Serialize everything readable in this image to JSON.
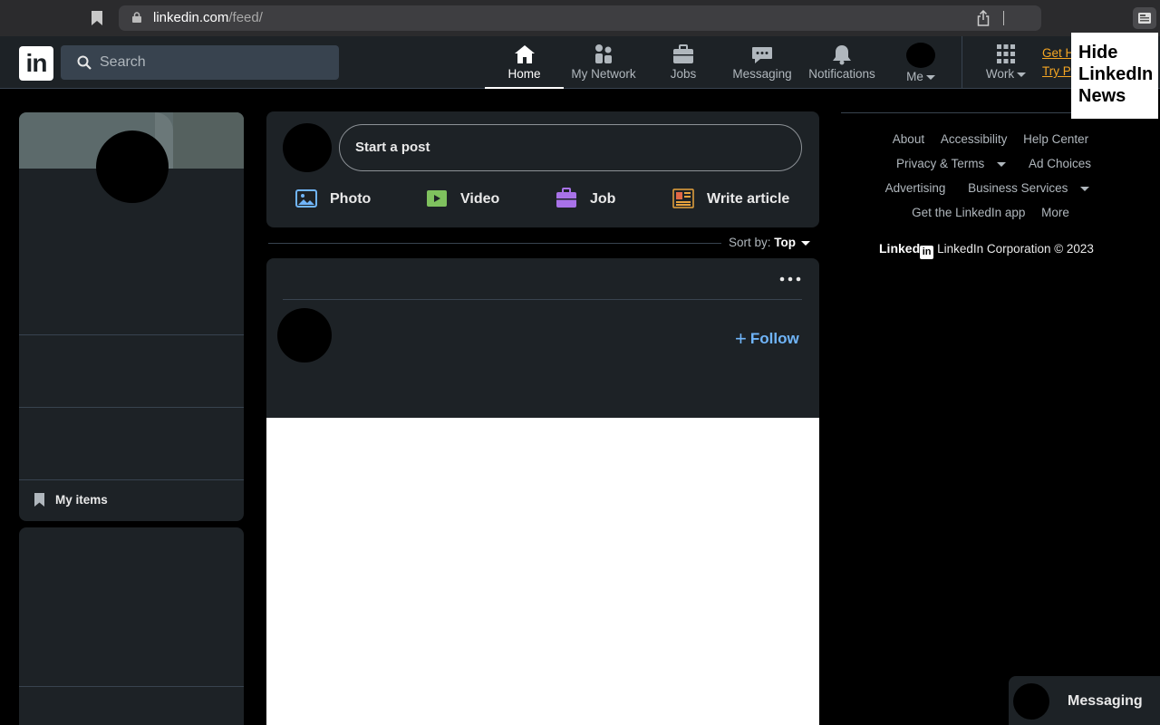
{
  "browser": {
    "url_host": "linkedin.com",
    "url_path": "/feed/"
  },
  "nav": {
    "logo": "in",
    "search_placeholder": "Search",
    "items": [
      {
        "label": "Home",
        "icon": "home-icon",
        "active": true
      },
      {
        "label": "My Network",
        "icon": "network-icon"
      },
      {
        "label": "Jobs",
        "icon": "briefcase-icon"
      },
      {
        "label": "Messaging",
        "icon": "messaging-icon"
      },
      {
        "label": "Notifications",
        "icon": "bell-icon"
      },
      {
        "label": "Me",
        "icon": "avatar"
      },
      {
        "label": "Work",
        "icon": "grid-icon"
      }
    ],
    "premium_line1": "Get H",
    "premium_line2": "Try P"
  },
  "hide_news": {
    "line1": "Hide",
    "line2": "LinkedIn",
    "line3": "News"
  },
  "left": {
    "my_items": "My items"
  },
  "composer": {
    "start_post": "Start a post",
    "actions": [
      {
        "label": "Photo",
        "icon": "photo-icon",
        "color": "#70b5f9"
      },
      {
        "label": "Video",
        "icon": "video-icon",
        "color": "#7fc15e"
      },
      {
        "label": "Job",
        "icon": "job-icon",
        "color": "#a872e8"
      },
      {
        "label": "Write article",
        "icon": "article-icon",
        "color": "#e7a33e"
      }
    ]
  },
  "sort": {
    "label": "Sort by:",
    "value": "Top"
  },
  "feed": {
    "follow": "Follow",
    "follow_color": "#70b5f9"
  },
  "footer": {
    "links": [
      "About",
      "Accessibility",
      "Help Center",
      "Privacy & Terms",
      "Ad Choices",
      "Advertising",
      "Business Services",
      "Get the LinkedIn app",
      "More"
    ],
    "brand": "Linked",
    "brand_box": "in",
    "copyright": "LinkedIn Corporation © 2023"
  },
  "messaging": {
    "label": "Messaging"
  }
}
